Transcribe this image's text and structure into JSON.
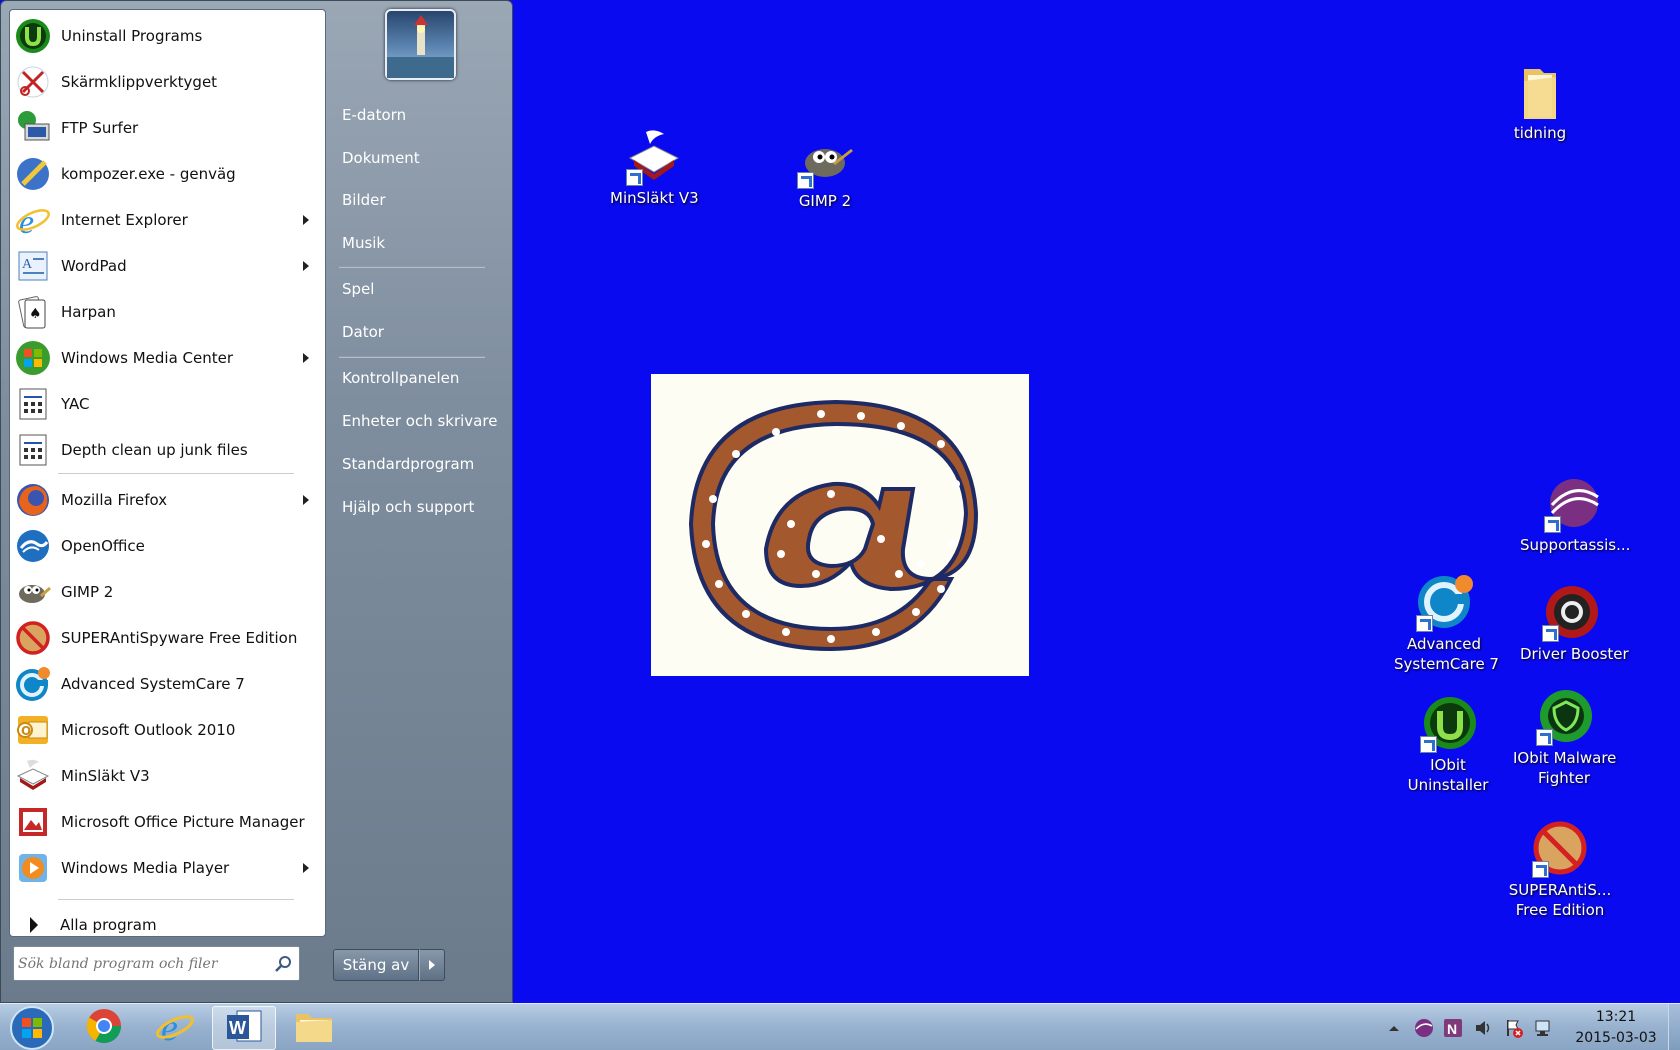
{
  "start_menu": {
    "programs": [
      {
        "label": "Uninstall Programs",
        "icon": "iobit-uninstaller-icon",
        "submenu": false
      },
      {
        "label": "Skärmklippverktyget",
        "icon": "snipping-tool-icon",
        "submenu": false
      },
      {
        "label": "FTP Surfer",
        "icon": "ftp-surfer-icon",
        "submenu": false
      },
      {
        "label": "kompozer.exe - genväg",
        "icon": "kompozer-icon",
        "submenu": false
      },
      {
        "label": "Internet Explorer",
        "icon": "internet-explorer-icon",
        "submenu": true
      },
      {
        "label": "WordPad",
        "icon": "wordpad-icon",
        "submenu": true
      },
      {
        "label": "Harpan",
        "icon": "solitaire-icon",
        "submenu": false
      },
      {
        "label": "Windows Media Center",
        "icon": "media-center-icon",
        "submenu": true
      },
      {
        "label": "YAC",
        "icon": "yac-icon",
        "submenu": false
      },
      {
        "label": "Depth clean up junk files",
        "icon": "junk-cleaner-icon",
        "submenu": false
      },
      {
        "label": "Mozilla Firefox",
        "icon": "firefox-icon",
        "submenu": true
      },
      {
        "label": "OpenOffice",
        "icon": "openoffice-icon",
        "submenu": false
      },
      {
        "label": "GIMP 2",
        "icon": "gimp-icon",
        "submenu": false
      },
      {
        "label": "SUPERAntiSpyware Free Edition",
        "icon": "superantispyware-icon",
        "submenu": false
      },
      {
        "label": "Advanced SystemCare 7",
        "icon": "advanced-systemcare-icon",
        "submenu": false
      },
      {
        "label": "Microsoft Outlook 2010",
        "icon": "outlook-icon",
        "submenu": false
      },
      {
        "label": "MinSläkt V3",
        "icon": "minslakt-icon",
        "submenu": false
      },
      {
        "label": "Microsoft Office Picture Manager",
        "icon": "picture-manager-icon",
        "submenu": false
      },
      {
        "label": "Windows Media Player",
        "icon": "media-player-icon",
        "submenu": true
      }
    ],
    "all_programs": "Alla program",
    "search_placeholder": "Sök bland program och filer",
    "places": [
      "E-datorn",
      "Dokument",
      "Bilder",
      "Musik",
      "Spel",
      "Dator",
      "Kontrollpanelen",
      "Enheter och skrivare",
      "Standardprogram",
      "Hjälp och support"
    ],
    "shutdown_label": "Stäng av"
  },
  "desktop": {
    "background_color": "#0a0af0",
    "icons": [
      {
        "label": "MinSläkt V3",
        "icon": "minslakt-icon"
      },
      {
        "label": "GIMP 2",
        "icon": "gimp-icon"
      },
      {
        "label": "tidning",
        "icon": "folder-icon"
      },
      {
        "label": "Supportassis...",
        "icon": "supportassistant-icon"
      },
      {
        "label_lines": [
          "Advanced",
          "SystemCare 7"
        ],
        "icon": "advanced-systemcare-icon"
      },
      {
        "label": "Driver Booster",
        "icon": "driver-booster-icon"
      },
      {
        "label_lines": [
          "IObit",
          "Uninstaller"
        ],
        "icon": "iobit-uninstaller-icon"
      },
      {
        "label_lines": [
          "IObit Malware",
          "Fighter"
        ],
        "icon": "malware-fighter-icon"
      },
      {
        "label_lines": [
          "SUPERAntiS...",
          "Free Edition"
        ],
        "icon": "superantispyware-icon"
      }
    ],
    "wallpaper_glyph": "@"
  },
  "taskbar": {
    "pinned": [
      "chrome-icon",
      "internet-explorer-icon",
      "word-icon",
      "file-explorer-icon"
    ],
    "active": "word-icon",
    "clock_time": "13:21",
    "clock_date": "2015-03-03"
  }
}
